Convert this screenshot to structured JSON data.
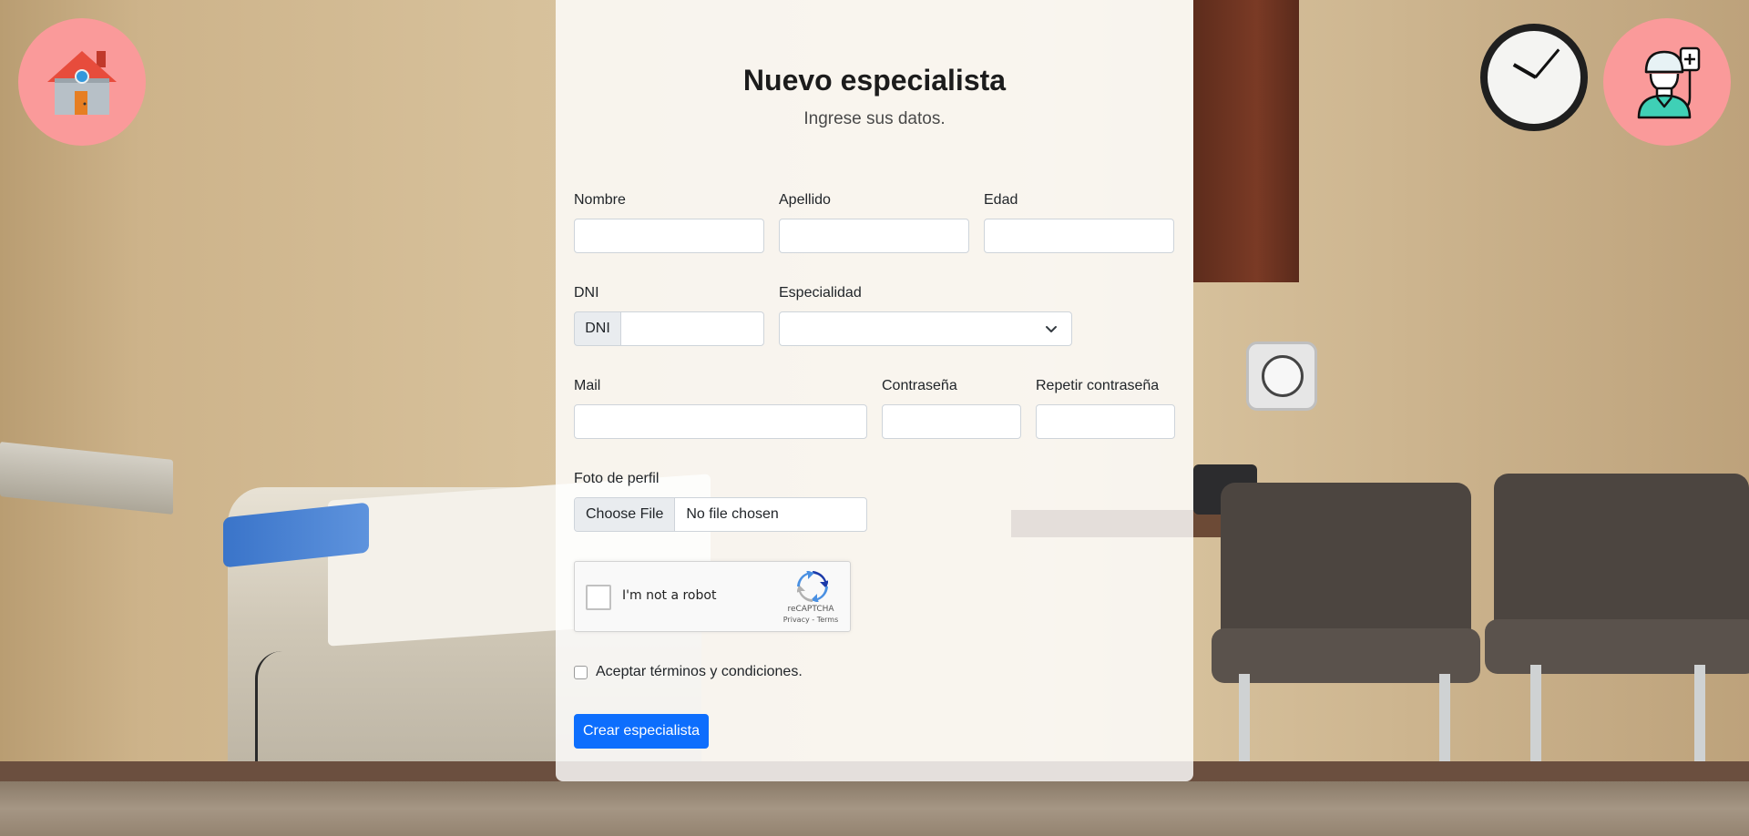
{
  "form": {
    "title": "Nuevo especialista",
    "subtitle": "Ingrese sus datos.",
    "nombre_label": "Nombre",
    "nombre_value": "",
    "apellido_label": "Apellido",
    "apellido_value": "",
    "edad_label": "Edad",
    "edad_value": "",
    "dni_label": "DNI",
    "dni_addon": "DNI",
    "dni_value": "",
    "especialidad_label": "Especialidad",
    "especialidad_selected": "",
    "mail_label": "Mail",
    "mail_value": "",
    "password_label": "Contraseña",
    "password_value": "",
    "repeat_password_label": "Repetir contraseña",
    "repeat_password_value": "",
    "photo_label": "Foto de perfil",
    "photo_button": "Choose File",
    "photo_filename": "No file chosen",
    "captcha_text": "I'm not a robot",
    "captcha_brand": "reCAPTCHA",
    "captcha_links": "Privacy - Terms",
    "terms_label": "Aceptar términos y condiciones.",
    "terms_checked": false,
    "submit_label": "Crear especialista"
  },
  "nav": {
    "home_icon": "home-icon",
    "specialist_icon": "medical-specialist-icon"
  },
  "colors": {
    "accent": "#0d6efd",
    "corner_button_bg": "#fa9a9a"
  }
}
